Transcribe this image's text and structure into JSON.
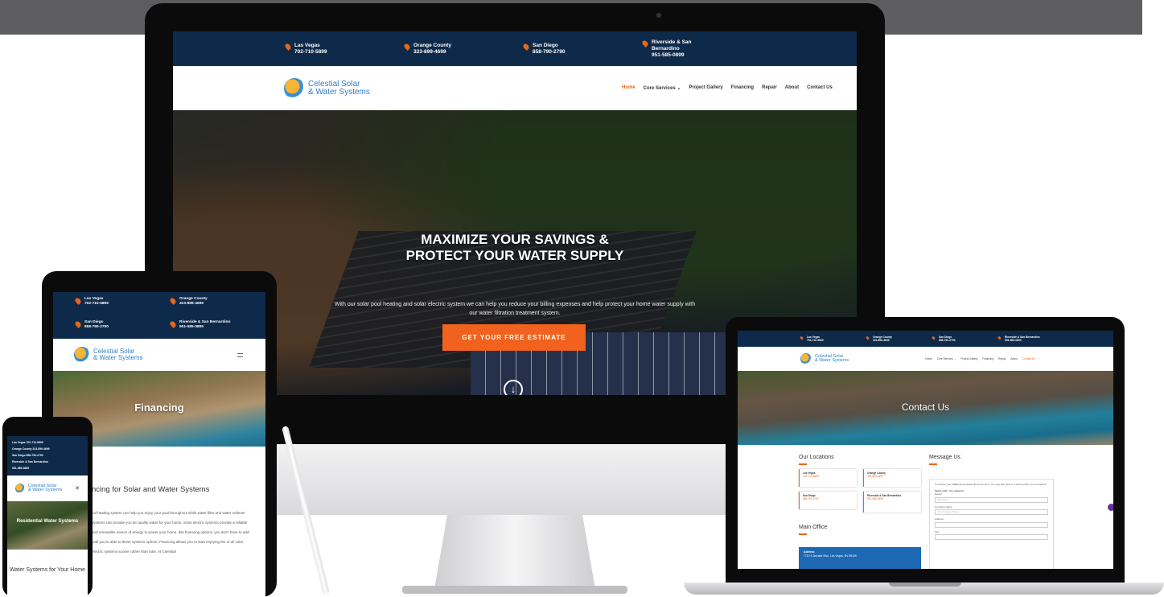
{
  "desktop": {
    "locations": [
      {
        "name": "Las Vegas",
        "phone": "702-710-5899"
      },
      {
        "name": "Orange County",
        "phone": "323-899-4699"
      },
      {
        "name": "San Diego",
        "phone": "858-790-2790"
      },
      {
        "name": "Riverside & San Bernardino",
        "phone": "951-585-0899"
      }
    ],
    "logo_line1": "Celestial Solar",
    "logo_line2": "& Water Systems",
    "menu": [
      "Home",
      "Core Services ⌄",
      "Project Gallery",
      "Financing",
      "Repair",
      "About",
      "Contact Us"
    ],
    "hero_title_line1": "MAXIMIZE YOUR SAVINGS &",
    "hero_title_line2": "PROTECT YOUR WATER SUPPLY",
    "hero_sub": "With our solar pool heating and solar electric system we can help you reduce your billing expenses and help protect your home water supply with our water filtration treatment system.",
    "cta": "GET YOUR FREE ESTIMATE",
    "arrow": "↓"
  },
  "tablet": {
    "locations": [
      {
        "name": "Las Vegas",
        "phone": "702-710-5899"
      },
      {
        "name": "Orange County",
        "phone": "323-899-4699"
      },
      {
        "name": "San Diego",
        "phone": "858-790-2790"
      },
      {
        "name": "Riverside & San Bernardino",
        "phone": "951-585-0899"
      }
    ],
    "hero_title": "Financing",
    "heading": "ncing for Solar and Water Systems",
    "para": "ool heating system can help you enjoy your pool throughout while water filter and water softener systems can provide you ter quality water for your home. Solar electric systems provide a reliable and renewable source of energy to power your home. ible financing options, you don't have to wait until you're able to these systems upfront. Financing allows you to start enjoying the of all solar electric systems sooner rather than later. At Celestial"
  },
  "phone": {
    "locations": [
      "Las Vegas 702-710-5899",
      "Orange County 323-899-4699",
      "San Diego 858-790-2790",
      "Riverside & San Bernardino",
      "951-585-0899"
    ],
    "close": "✕",
    "hero_title": "Residential Water Systems",
    "subtitle": "Water Systems for Your Home"
  },
  "laptop": {
    "locations": [
      {
        "name": "Las Vegas",
        "phone": "702-710-5899"
      },
      {
        "name": "Orange County",
        "phone": "323-899-4699"
      },
      {
        "name": "San Diego",
        "phone": "858-790-2790"
      },
      {
        "name": "Riverside & San Bernardino",
        "phone": "951-585-0899"
      }
    ],
    "menu": [
      "Home",
      "Core Services ⌄",
      "Project Gallery",
      "Financing",
      "Repair",
      "About",
      "Contact Us"
    ],
    "hero_title": "Contact Us",
    "our_locations": "Our Locations",
    "message_us": "Message Us",
    "cards": [
      {
        "name": "Las Vegas",
        "phone": "702-710-5899"
      },
      {
        "name": "Orange County",
        "phone": "323-899-4699"
      },
      {
        "name": "San Diego",
        "phone": "858-790-2790"
      },
      {
        "name": "Riverside & San Bernardino",
        "phone": "951-585-0899"
      }
    ],
    "main_office": "Main Office",
    "office_label": "Address",
    "office_address": "7710 S Decatur Blvd, Las Vegas, NV 89139",
    "form_intro": "To receive your FREE quote please fill out the form. You may also give us a call to either of our locations.",
    "form_fields": [
      "Fields with * are required",
      "Name*",
      "Company Name",
      "Address",
      "City"
    ],
    "name_placeholder": "First Name",
    "company_placeholder": "Your Company Name"
  },
  "colors": {
    "navy": "#0e2a4a",
    "accent": "#f0621e",
    "logo_blue": "#2f7fd0"
  }
}
